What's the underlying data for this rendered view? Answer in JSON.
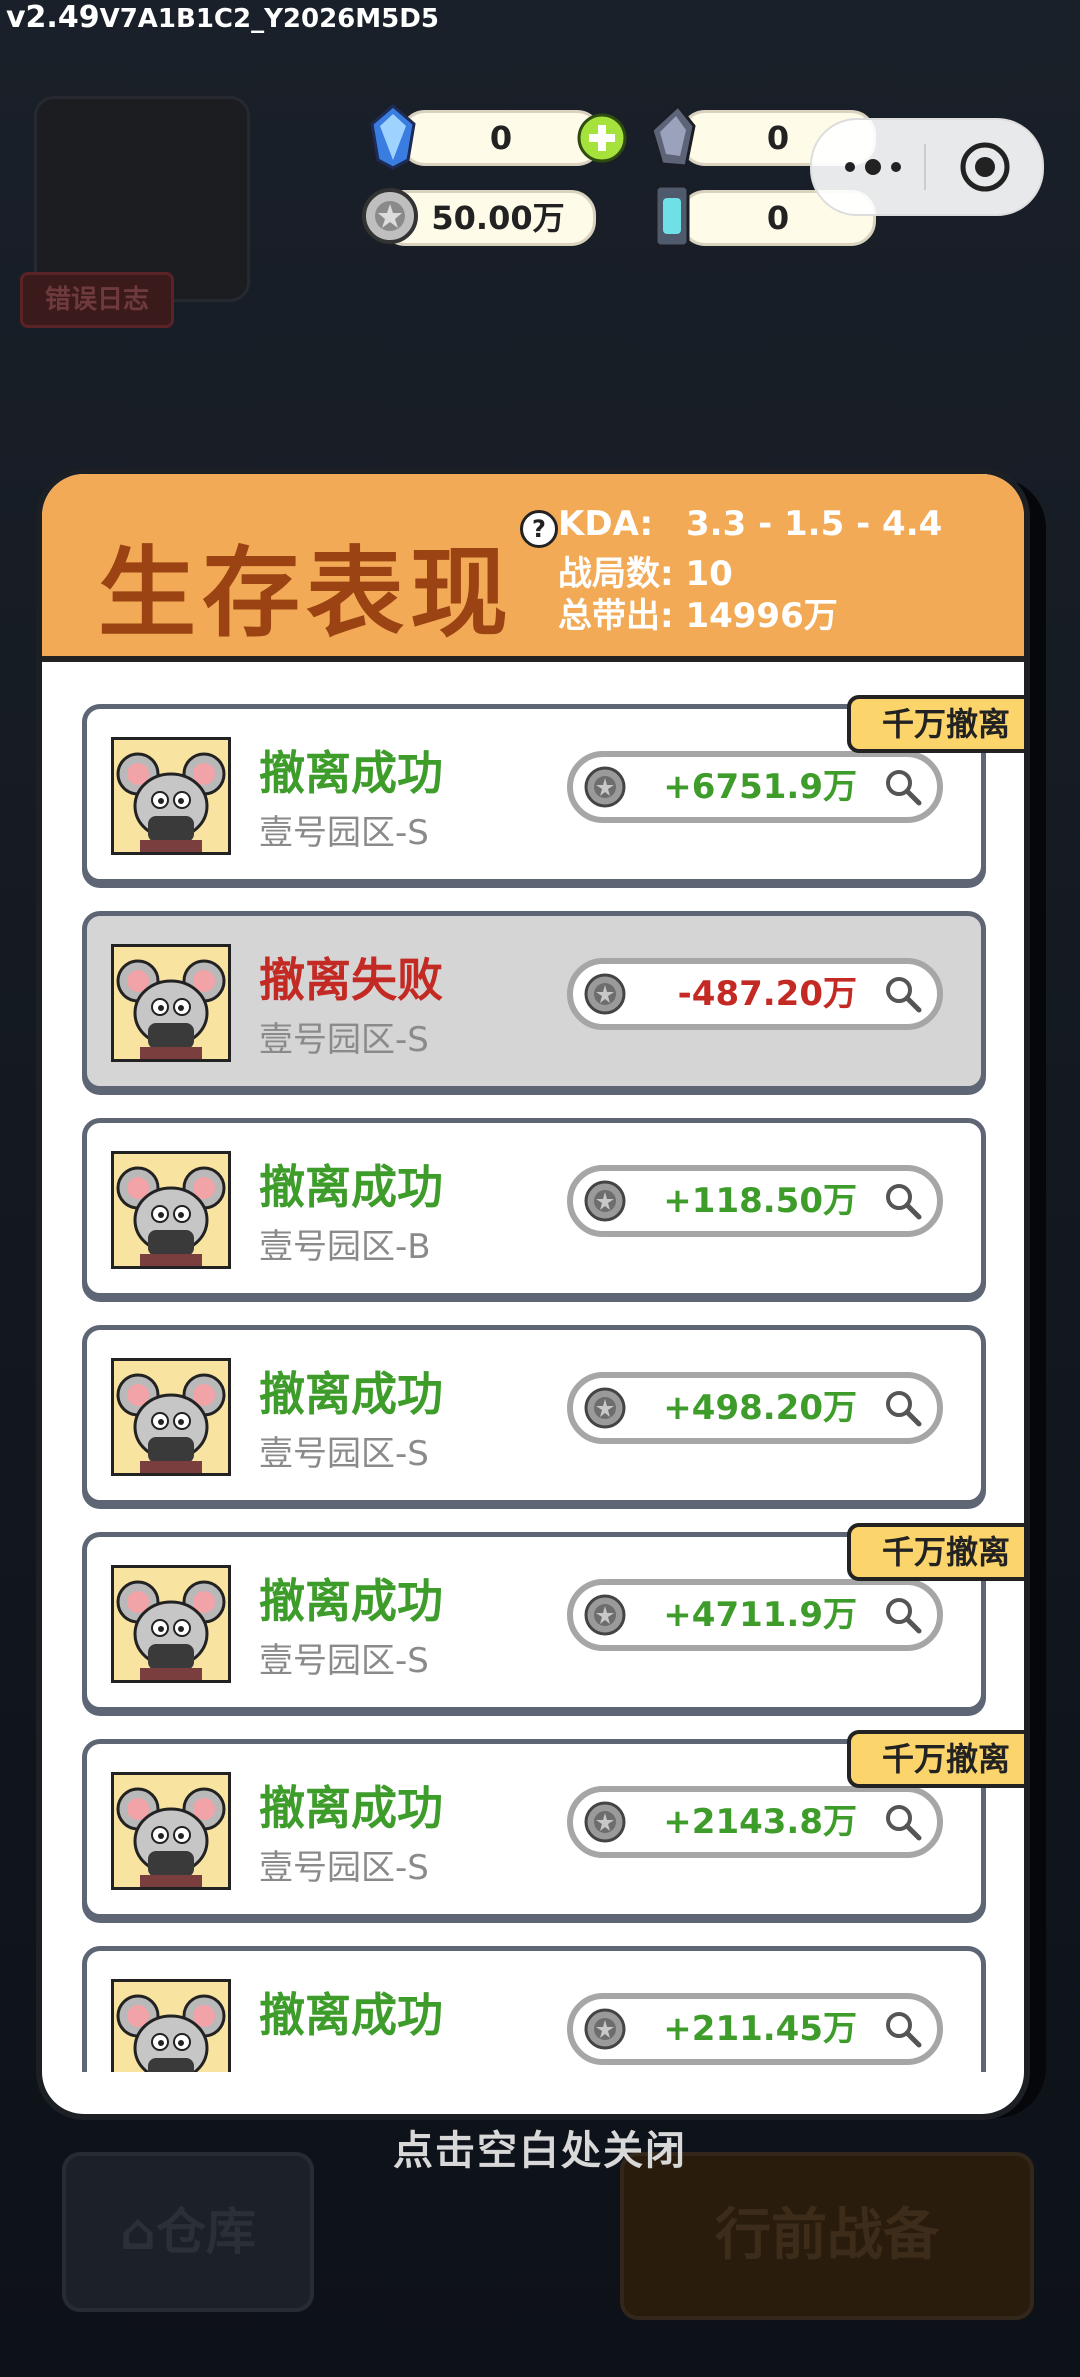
{
  "version": {
    "main": "v2.49",
    "build": "V7A1B1C2_Y2026M5D5"
  },
  "error_log": "错误日志",
  "currency": {
    "gem": "0",
    "crystal": "0",
    "coins": "50.00万",
    "battery": "0"
  },
  "panel": {
    "title": "生存表现",
    "help": "?",
    "kda_label": "KDA:",
    "kda_value": "3.3 - 1.5 - 4.4",
    "matches_label": "战局数:",
    "matches_value": "10",
    "output_label": "总带出:",
    "output_value": "14996万"
  },
  "records": [
    {
      "status": "撤离成功",
      "zone": "壹号园区-S",
      "amount": "+6751.9万",
      "tag": "千万撤离",
      "result": "success"
    },
    {
      "status": "撤离失败",
      "zone": "壹号园区-S",
      "amount": "-487.20万",
      "tag": "",
      "result": "fail"
    },
    {
      "status": "撤离成功",
      "zone": "壹号园区-B",
      "amount": "+118.50万",
      "tag": "",
      "result": "success"
    },
    {
      "status": "撤离成功",
      "zone": "壹号园区-S",
      "amount": "+498.20万",
      "tag": "",
      "result": "success"
    },
    {
      "status": "撤离成功",
      "zone": "壹号园区-S",
      "amount": "+4711.9万",
      "tag": "千万撤离",
      "result": "success"
    },
    {
      "status": "撤离成功",
      "zone": "壹号园区-S",
      "amount": "+2143.8万",
      "tag": "千万撤离",
      "result": "success"
    },
    {
      "status": "撤离成功",
      "zone": "",
      "amount": "+211.45万",
      "tag": "",
      "result": "success"
    }
  ],
  "close_hint": "点击空白处关闭",
  "bottom": {
    "warehouse": "仓库",
    "prepare": "行前战备"
  },
  "colors": {
    "success": "#3e9c2b",
    "fail": "#c42a24",
    "header": "#f2aa56",
    "title": "#9b4313",
    "tag": "#fcd46c"
  }
}
